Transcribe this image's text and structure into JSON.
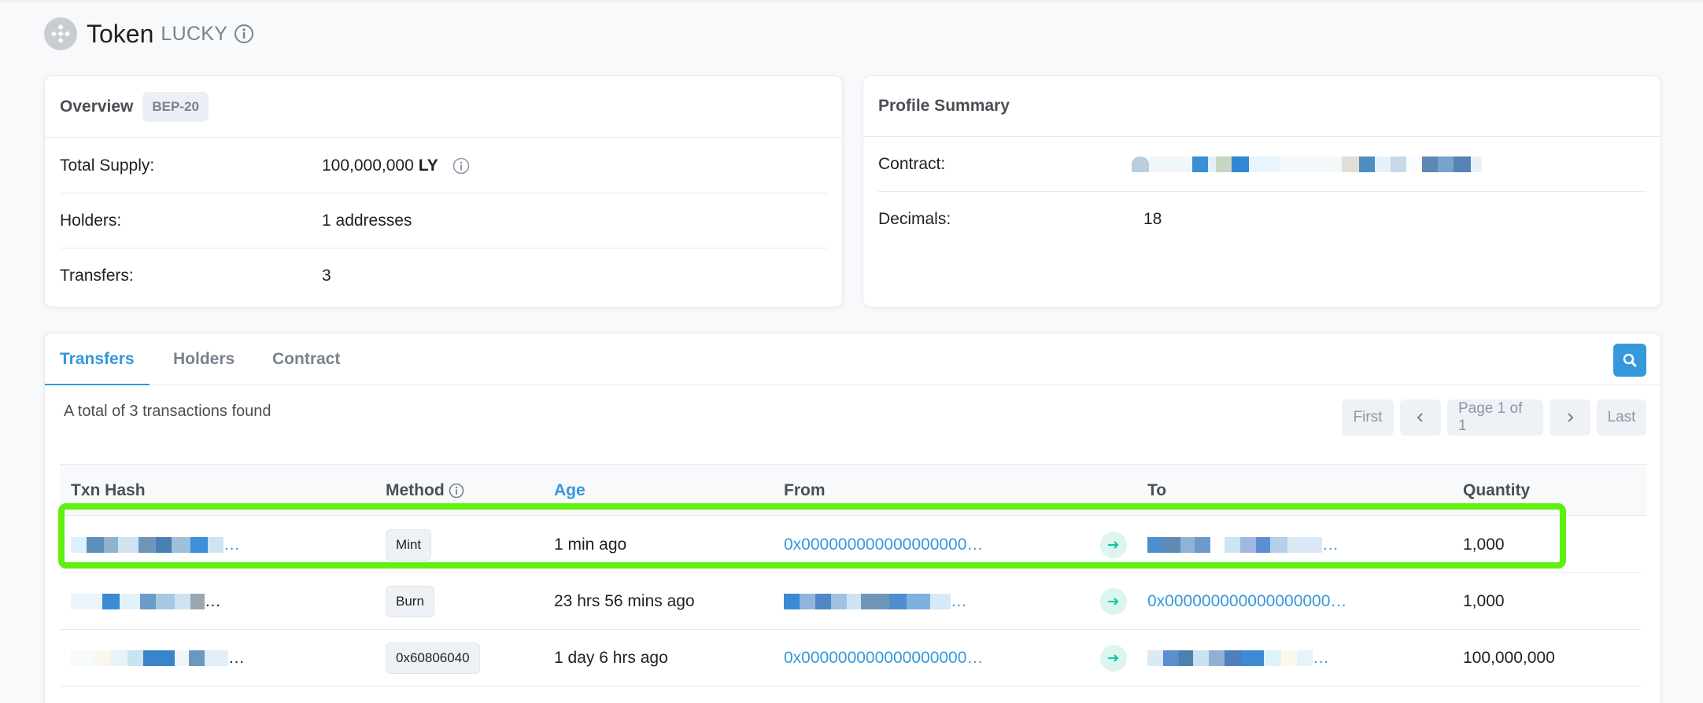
{
  "header": {
    "title": "Token",
    "subtitle": "LUCKY"
  },
  "overview": {
    "title": "Overview",
    "badge": "BEP-20",
    "rows": [
      {
        "label": "Total Supply:",
        "value": "100,000,000",
        "unit": "LY"
      },
      {
        "label": "Holders:",
        "value": "1 addresses"
      },
      {
        "label": "Transfers:",
        "value": "3"
      }
    ]
  },
  "profile": {
    "title": "Profile Summary",
    "contract_label": "Contract:",
    "decimals_label": "Decimals:",
    "decimals_value": "18"
  },
  "tabs": [
    {
      "label": "Transfers",
      "active": true
    },
    {
      "label": "Holders",
      "active": false
    },
    {
      "label": "Contract",
      "active": false
    }
  ],
  "summary": "A total of 3 transactions found",
  "pager": {
    "first": "First",
    "page": "Page 1 of 1",
    "last": "Last"
  },
  "table": {
    "columns": [
      "Txn Hash",
      "Method",
      "Age",
      "From",
      "To",
      "Quantity"
    ],
    "rows": [
      {
        "method": "Mint",
        "age": "1 min ago",
        "from": "0x000000000000000000…",
        "to": "",
        "quantity": "1,000"
      },
      {
        "method": "Burn",
        "age": "23 hrs 56 mins ago",
        "from": "",
        "to": "0x000000000000000000…",
        "quantity": "1,000"
      },
      {
        "method": "0x60806040",
        "age": "1 day 6 hrs ago",
        "from": "0x000000000000000000…",
        "to": "",
        "quantity": "100,000,000"
      }
    ]
  },
  "icons": {
    "token_logo": "bnb-diamond-icon",
    "info": "info-circle-icon",
    "search": "search-icon",
    "prev": "chevron-left-icon",
    "next": "chevron-right-icon",
    "arrow": "arrow-right-icon"
  },
  "colors": {
    "accent": "#3498db",
    "highlight": "#5ef00f",
    "arrow_bg": "#dcf5ee",
    "arrow": "#00c9a7"
  }
}
